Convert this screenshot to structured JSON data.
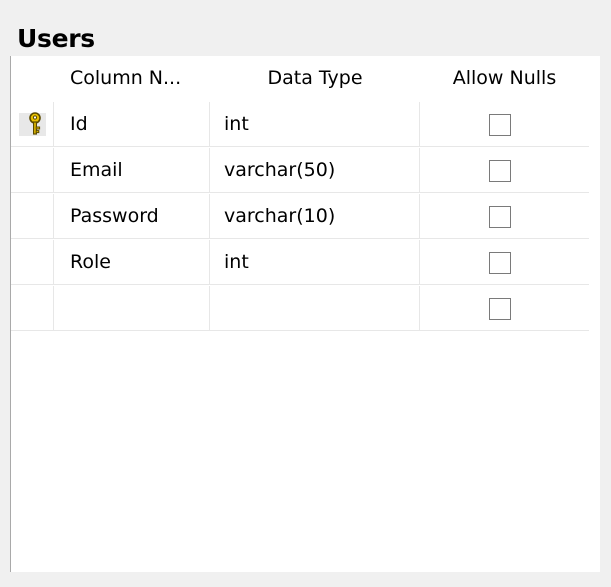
{
  "table": {
    "title": "Users",
    "columns": {
      "name_header": "Column N...",
      "type_header": "Data Type",
      "nulls_header": "Allow Nulls"
    },
    "rows": [
      {
        "name": "Id",
        "type": "int",
        "allow_nulls": false,
        "primary_key": true
      },
      {
        "name": "Email",
        "type": "varchar(50)",
        "allow_nulls": false,
        "primary_key": false
      },
      {
        "name": "Password",
        "type": "varchar(10)",
        "allow_nulls": false,
        "primary_key": false
      },
      {
        "name": "Role",
        "type": "int",
        "allow_nulls": false,
        "primary_key": false
      },
      {
        "name": "",
        "type": "",
        "allow_nulls": false,
        "primary_key": false
      }
    ],
    "icons": {
      "primary_key": "key-icon"
    },
    "colors": {
      "key_icon": "#e8c000",
      "key_outline": "#5a4a00",
      "gridline": "#e7e7e7"
    }
  }
}
